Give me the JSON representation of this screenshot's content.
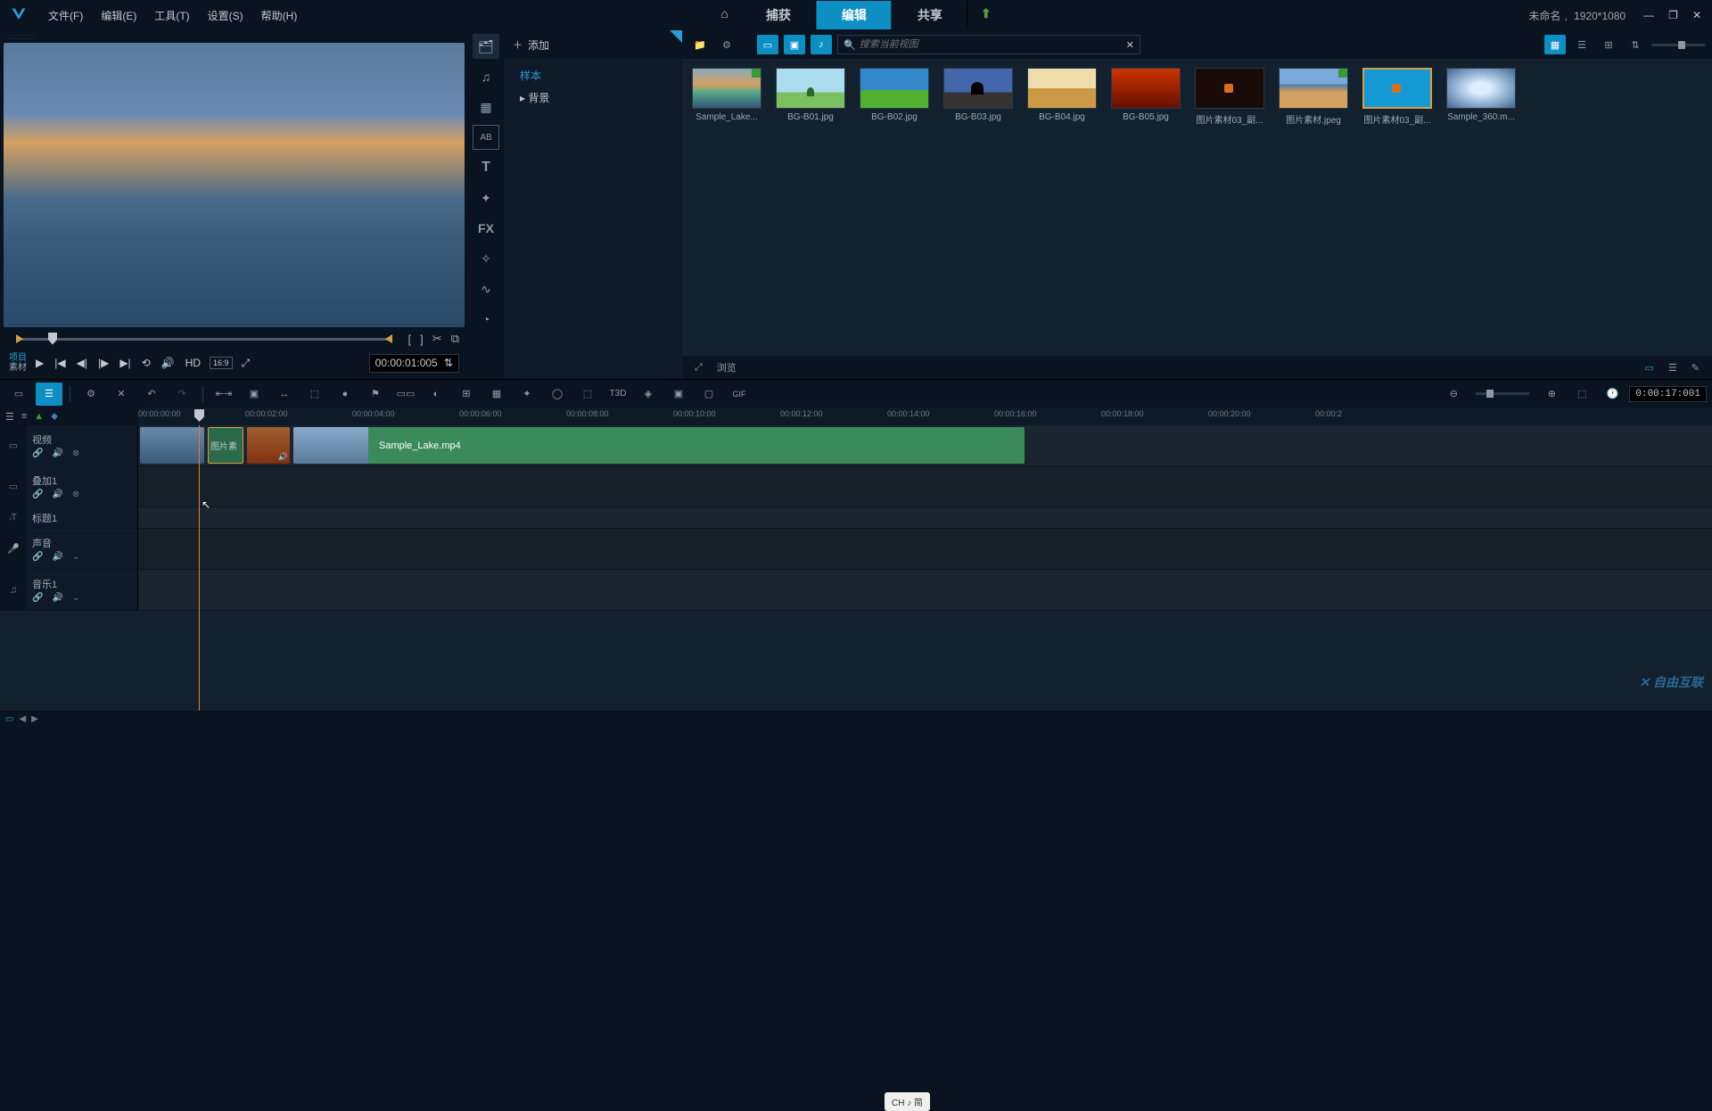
{
  "menu": {
    "file": "文件(F)",
    "edit": "编辑(E)",
    "tools": "工具(T)",
    "settings": "设置(S)",
    "help": "帮助(H)"
  },
  "top_tabs": {
    "capture": "捕获",
    "edit": "编辑",
    "share": "共享"
  },
  "project": {
    "name": "未命名",
    "resolution": "1920*1080"
  },
  "preview": {
    "mode_line1": "项目",
    "mode_line2": "素材",
    "timecode": "00:00:01:005",
    "hd": "HD",
    "aspect": "16:9"
  },
  "library": {
    "add": "添加",
    "tree": {
      "sample": "样本",
      "background": "背景"
    },
    "search_placeholder": "搜索当前视图",
    "browse": "浏览",
    "items": [
      {
        "label": "Sample_Lake...",
        "thumb": "th-lake",
        "check": true
      },
      {
        "label": "BG-B01.jpg",
        "thumb": "th-b01"
      },
      {
        "label": "BG-B02.jpg",
        "thumb": "th-b02"
      },
      {
        "label": "BG-B03.jpg",
        "thumb": "th-b03"
      },
      {
        "label": "BG-B04.jpg",
        "thumb": "th-b04"
      },
      {
        "label": "BG-B05.jpg",
        "thumb": "th-b05"
      },
      {
        "label": "图片素材03_副...",
        "thumb": "th-mat3"
      },
      {
        "label": "图片素材.jpeg",
        "thumb": "th-matj",
        "check": true
      },
      {
        "label": "图片素材03_副...",
        "thumb": "th-copy",
        "selected": true
      },
      {
        "label": "Sample_360.m...",
        "thumb": "th-360"
      }
    ]
  },
  "timeline": {
    "duration": "0:00:17:001",
    "ruler": [
      "00:00:00:00",
      "00:00:02:00",
      "00:00:04:00",
      "00:00:06:00",
      "00:00:08:00",
      "00:00:10:00",
      "00:00:12:00",
      "00:00:14:00",
      "00:00:16:00",
      "00:00:18:00",
      "00:00:20:00",
      "00:00:2"
    ],
    "tracks": {
      "video": "视频",
      "overlay": "叠加1",
      "title": "标题1",
      "sound": "声音",
      "music": "音乐1"
    },
    "clips": {
      "img1": "图片素",
      "video2": "Sample_Lake.mp4"
    }
  },
  "ime": "CH ♪ 简",
  "watermark": "自由互联"
}
